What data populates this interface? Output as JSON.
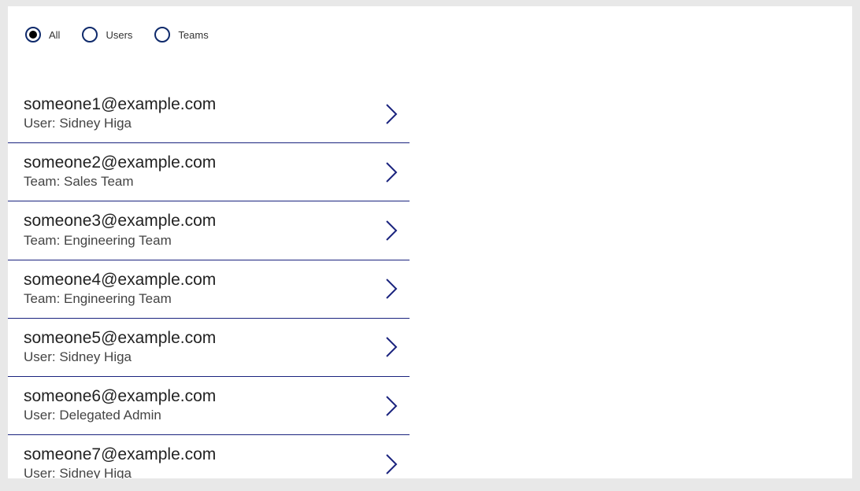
{
  "filters": [
    {
      "id": "all",
      "label": "All",
      "selected": true
    },
    {
      "id": "users",
      "label": "Users",
      "selected": false
    },
    {
      "id": "teams",
      "label": "Teams",
      "selected": false
    }
  ],
  "list": [
    {
      "email": "someone1@example.com",
      "detail": "User: Sidney Higa"
    },
    {
      "email": "someone2@example.com",
      "detail": "Team: Sales Team"
    },
    {
      "email": "someone3@example.com",
      "detail": "Team: Engineering Team"
    },
    {
      "email": "someone4@example.com",
      "detail": "Team: Engineering Team"
    },
    {
      "email": "someone5@example.com",
      "detail": "User: Sidney Higa"
    },
    {
      "email": "someone6@example.com",
      "detail": "User: Delegated Admin"
    },
    {
      "email": "someone7@example.com",
      "detail": "User: Sidney Higa"
    }
  ]
}
